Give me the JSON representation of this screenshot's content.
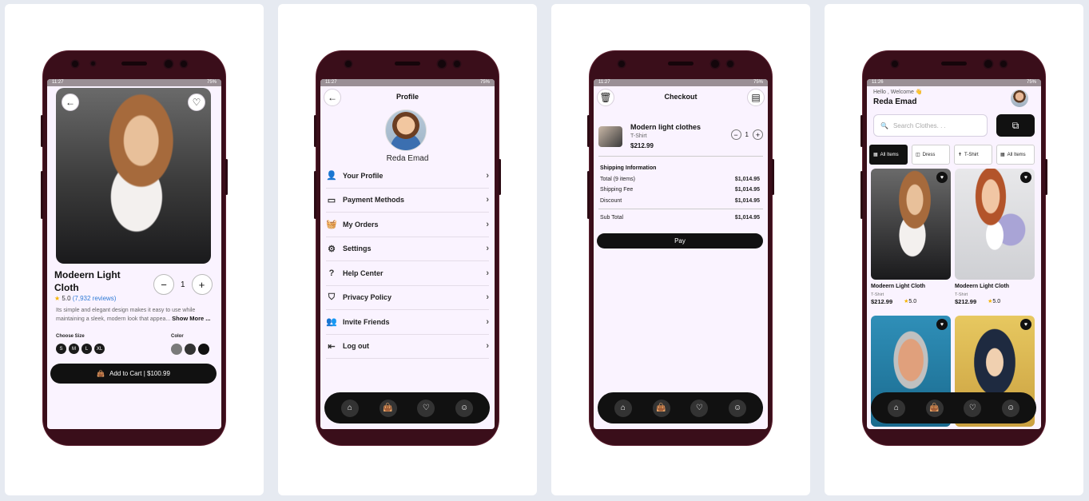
{
  "status": {
    "time1": "11:27",
    "time4": "11:26",
    "battery": "75%"
  },
  "detail": {
    "title": "Modeern Light Cloth",
    "rating": "5.0",
    "reviews": "(7,932 reviews)",
    "quantity": "1",
    "minus": "−",
    "plus": "+",
    "description": "Its simple and elegant design makes it easy to use while maintaining a sleek, modern look that appea...",
    "show_more": "Show More ...",
    "size_label": "Choose Size",
    "sizes": [
      "S",
      "M",
      "L",
      "XL"
    ],
    "color_label": "Color",
    "colors": [
      "#7a7a7a",
      "#333333",
      "#111111"
    ],
    "cart_button": "Add to Cart | $100.99"
  },
  "profile": {
    "title": "Profile",
    "name": "Reda Emad",
    "menu": [
      {
        "label": "Your Profile",
        "icon": "user-icon"
      },
      {
        "label": "Payment Methods",
        "icon": "card-icon"
      },
      {
        "label": "My Orders",
        "icon": "basket-icon"
      },
      {
        "label": "Settings",
        "icon": "gear-icon"
      },
      {
        "label": "Help Center",
        "icon": "help-icon"
      },
      {
        "label": "Privacy Policy",
        "icon": "shield-icon"
      },
      {
        "label": "Invite Friends",
        "icon": "invite-icon"
      },
      {
        "label": "Log out",
        "icon": "logout-icon"
      }
    ]
  },
  "checkout": {
    "title": "Checkout",
    "item_name": "Modern light clothes",
    "item_type": "T-Shirt",
    "item_price": "$212.99",
    "quantity": "1",
    "shipping_title": "Shipping Information",
    "rows": [
      {
        "label": "Total (9 items)",
        "value": "$1,014.95"
      },
      {
        "label": "Shipping Fee",
        "value": "$1,014.95"
      },
      {
        "label": "Discount",
        "value": "$1,014.95"
      }
    ],
    "subtotal_label": "Sub Total",
    "subtotal_value": "$1,014.95",
    "pay_button": "Pay"
  },
  "home": {
    "greeting": "Hello , Welcome 👋",
    "name": "Reda Emad",
    "search_placeholder": "Search Clothes. . .",
    "chips": [
      "All Items",
      "Dress",
      "T-Shirt",
      "All Items"
    ],
    "products": [
      {
        "name": "Modeern Light Cloth",
        "category": "T-Shirt",
        "price": "$212.99",
        "rating": "5.0"
      },
      {
        "name": "Modeern Light Cloth",
        "category": "T-Shirt",
        "price": "$212.99",
        "rating": "5.0"
      }
    ]
  },
  "nav_icons": [
    "home-icon",
    "bag-icon",
    "heart-icon",
    "profile-icon"
  ]
}
